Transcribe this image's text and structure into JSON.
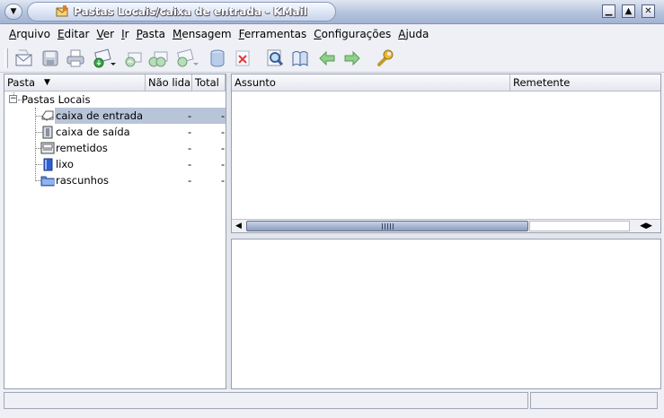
{
  "window": {
    "title": "Pastas Locais/caixa de entrada - KMail"
  },
  "menubar": [
    {
      "accel": "A",
      "rest": "rquivo"
    },
    {
      "accel": "E",
      "rest": "ditar"
    },
    {
      "accel": "V",
      "rest": "er"
    },
    {
      "accel": "I",
      "rest": "r"
    },
    {
      "accel": "P",
      "rest": "asta"
    },
    {
      "accel": "M",
      "rest": "ensagem"
    },
    {
      "accel": "F",
      "rest": "erramentas"
    },
    {
      "accel": "C",
      "rest": "onfigurações"
    },
    {
      "accel": "A",
      "rest": "juda"
    }
  ],
  "toolbar": [
    "new-message-icon",
    "save-icon",
    "print-icon",
    "check-mail-icon",
    "reply-icon",
    "reply-all-icon",
    "forward-icon",
    "trash-can-icon",
    "delete-icon",
    "find-icon",
    "address-book-icon",
    "previous-icon",
    "next-icon",
    "settings-wrench-icon"
  ],
  "folders": {
    "columns": {
      "pasta": "Pasta",
      "unread": "Não lida",
      "total": "Total"
    },
    "root": "Pastas Locais",
    "items": [
      {
        "name": "caixa de entrada",
        "unread": "-",
        "total": "-",
        "selected": true
      },
      {
        "name": "caixa de saída",
        "unread": "-",
        "total": "-"
      },
      {
        "name": "remetidos",
        "unread": "-",
        "total": "-"
      },
      {
        "name": "lixo",
        "unread": "-",
        "total": "-"
      },
      {
        "name": "rascunhos",
        "unread": "-",
        "total": "-"
      }
    ]
  },
  "headers": {
    "columns": {
      "subject": "Assunto",
      "sender": "Remetente"
    }
  },
  "colors": {
    "selection": "#b8c4d8",
    "titlebar": "#b5c3dc"
  }
}
